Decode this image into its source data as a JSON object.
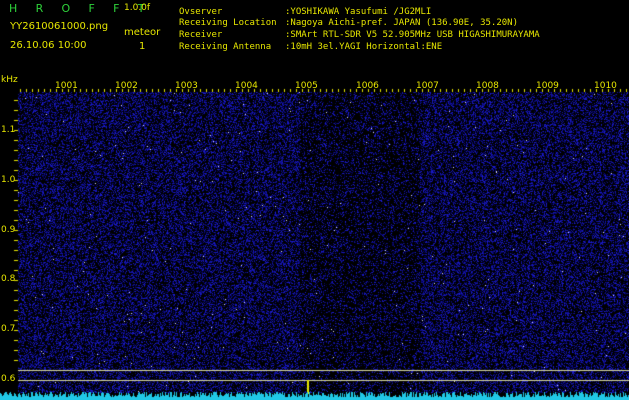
{
  "header": {
    "app_title": "H R O F F T",
    "app_version": "1.0.0f",
    "file_name": "YY2610061000.png",
    "meteor_label": "meteor",
    "datetime": "26.10.06 10:00",
    "meteor_count": "1"
  },
  "info": [
    {
      "key": "Ovserver",
      "value": ":YOSHIKAWA Yasufumi /JG2MLI"
    },
    {
      "key": "Receiving Location",
      "value": ":Nagoya Aichi-pref. JAPAN (136.90E, 35.20N)"
    },
    {
      "key": "Receiver",
      "value": ":SMArt RTL-SDR V5 52.905MHz USB HIGASHIMURAYAMA"
    },
    {
      "key": "Receiving Antenna",
      "value": ":10mH 3el.YAGI Horizontal:ENE"
    }
  ],
  "axes": {
    "y_unit": "kHz",
    "y_ticks": [
      "1.1",
      "1.0",
      "0.9",
      "0.8",
      "0.7",
      "0.6"
    ],
    "x_ticks": [
      "1001",
      "1002",
      "1003",
      "1004",
      "1005",
      "1006",
      "1007",
      "1008",
      "1009",
      "1010"
    ]
  },
  "colors": {
    "background": "#000000",
    "text": "#e6e600",
    "title": "#2ed13a",
    "noise": "#2424c8",
    "spectrum": "#20c8e6",
    "reference_line": "#d8d8a0"
  }
}
